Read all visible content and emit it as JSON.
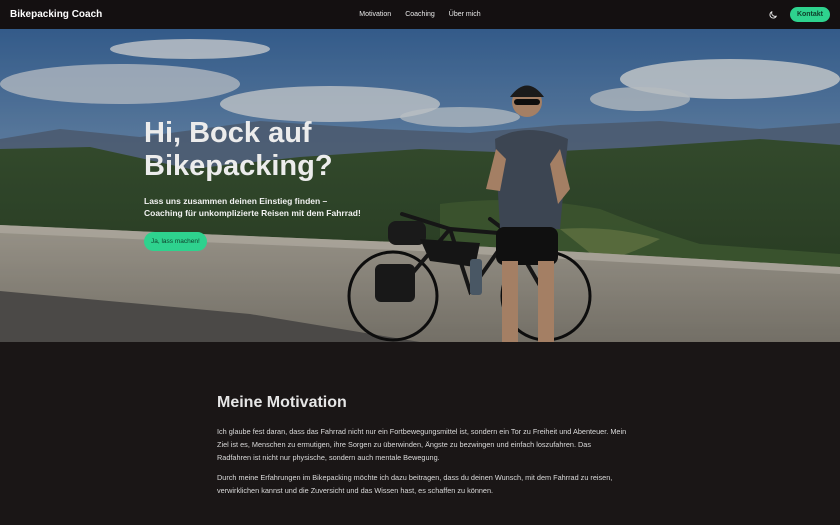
{
  "nav": {
    "brand": "Bikepacking Coach",
    "links": [
      "Motivation",
      "Coaching",
      "Über mich"
    ],
    "theme_icon": "moon-icon",
    "contact_label": "Kontakt"
  },
  "hero": {
    "title_line1": "Hi, Bock auf",
    "title_line2": "Bikepacking?",
    "subtitle_line1": "Lass uns zusammen deinen Einstieg finden –",
    "subtitle_line2": "Coaching für unkomplizierte Reisen mit dem Fahrrad!",
    "cta_label": "Ja, lass machen!"
  },
  "motivation": {
    "title": "Meine Motivation",
    "paragraph1": "Ich glaube fest daran, dass das Fahrrad nicht nur ein Fortbewegungsmittel ist, sondern ein Tor zu Freiheit und Abenteuer. Mein Ziel ist es, Menschen zu ermutigen, ihre Sorgen zu überwinden, Ängste zu bezwingen und einfach loszufahren. Das Radfahren ist nicht nur physische, sondern auch mentale Bewegung.",
    "paragraph2": "Durch meine Erfahrungen im Bikepacking möchte ich dazu beitragen, dass du deinen Wunsch, mit dem Fahrrad zu reisen, verwirklichen kannst und die Zuversicht und das Wissen hast, es schaffen zu können."
  },
  "colors": {
    "accent": "#2ed28e",
    "navbar_bg": "#141011",
    "page_bg": "#1a1616"
  }
}
